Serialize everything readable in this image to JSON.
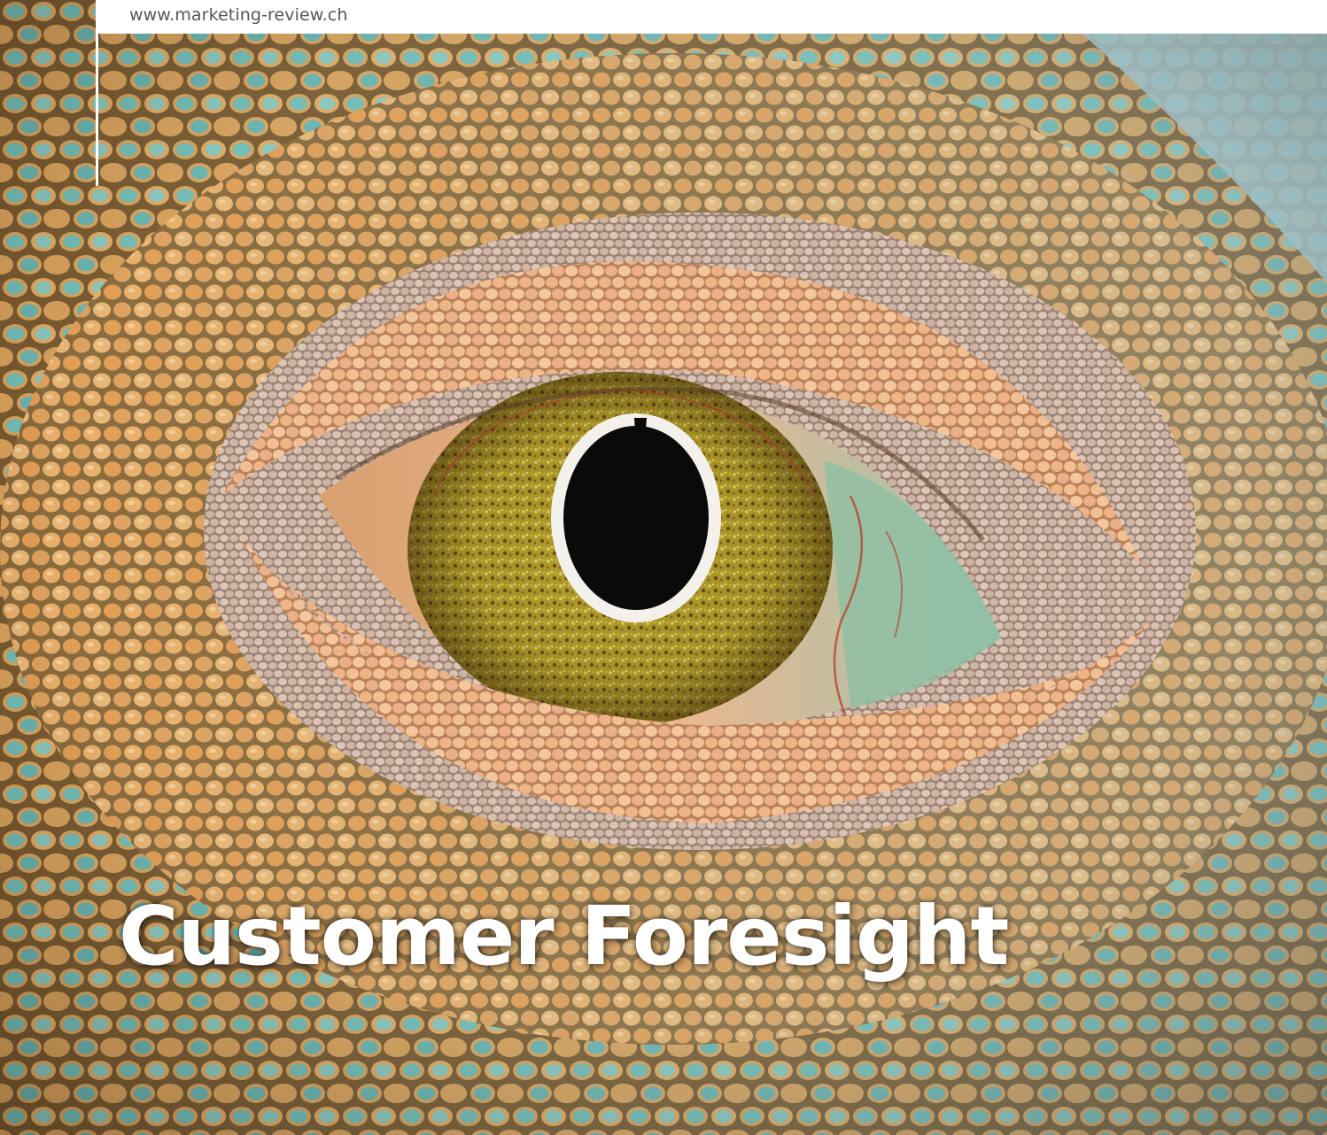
{
  "header": {
    "url": "www.marketing-review.ch"
  },
  "cover": {
    "title": "Customer Foresight"
  },
  "colors": {
    "scale_orange": "#e9a95e",
    "scale_teal": "#6fb9b4",
    "iris_yellow": "#c9b43a",
    "pupil": "#0a0a0a",
    "title_text": "#ffffff"
  }
}
